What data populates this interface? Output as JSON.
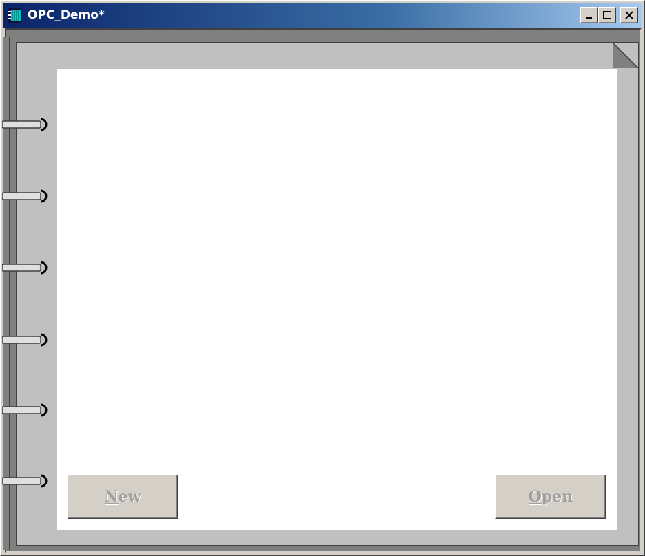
{
  "window": {
    "title": "OPC_Demo*"
  },
  "title_controls": {
    "minimize_icon": "minimize-icon",
    "maximize_icon": "maximize-icon",
    "close_icon": "close-icon"
  },
  "buttons": {
    "new_label": "New",
    "open_label": "Open"
  },
  "colors": {
    "titlebar_start": "#0a246a",
    "titlebar_end": "#a6caf0",
    "face": "#d4d0c8",
    "notebook": "#c0c0c0",
    "page": "#ffffff",
    "disabled_text": "#a0a0a0"
  },
  "icons": {
    "app": "notebook-app-icon",
    "corner": "page-corner-fold-icon",
    "rings": "spiral-ring-icon"
  }
}
